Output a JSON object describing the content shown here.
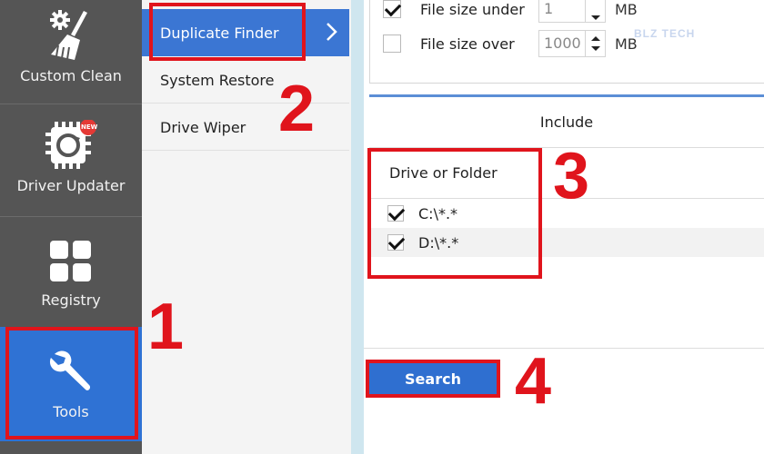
{
  "left_nav": {
    "items": [
      {
        "label": "Custom Clean",
        "icon": "gear-broom-icon"
      },
      {
        "label": "Driver Updater",
        "icon": "chip-refresh-icon",
        "badge": "NEW"
      },
      {
        "label": "Registry",
        "icon": "grid-squares-icon"
      },
      {
        "label": "Tools",
        "icon": "wrench-icon",
        "selected": true
      }
    ]
  },
  "submenu": {
    "items": [
      {
        "label": "Duplicate Finder",
        "selected": true
      },
      {
        "label": "System Restore"
      },
      {
        "label": "Drive Wiper"
      }
    ]
  },
  "filters": {
    "size_under": {
      "label": "File size under",
      "value": "1",
      "unit": "MB",
      "checked": true
    },
    "size_over": {
      "label": "File size over",
      "value": "1000",
      "unit": "MB",
      "checked": false
    },
    "watermark": "BLZ TECH"
  },
  "include": {
    "header": "Include",
    "column_header": "Drive or Folder",
    "rows": [
      {
        "path": "C:\\*.*",
        "checked": true
      },
      {
        "path": "D:\\*.*",
        "checked": true
      }
    ]
  },
  "actions": {
    "search_label": "Search"
  },
  "annotations": {
    "step1": "1",
    "step2": "2",
    "step3": "3",
    "step4": "4"
  },
  "colors": {
    "accent": "#2f72d4",
    "annotation_red": "#e0141c",
    "sidebar_bg": "#555555"
  }
}
